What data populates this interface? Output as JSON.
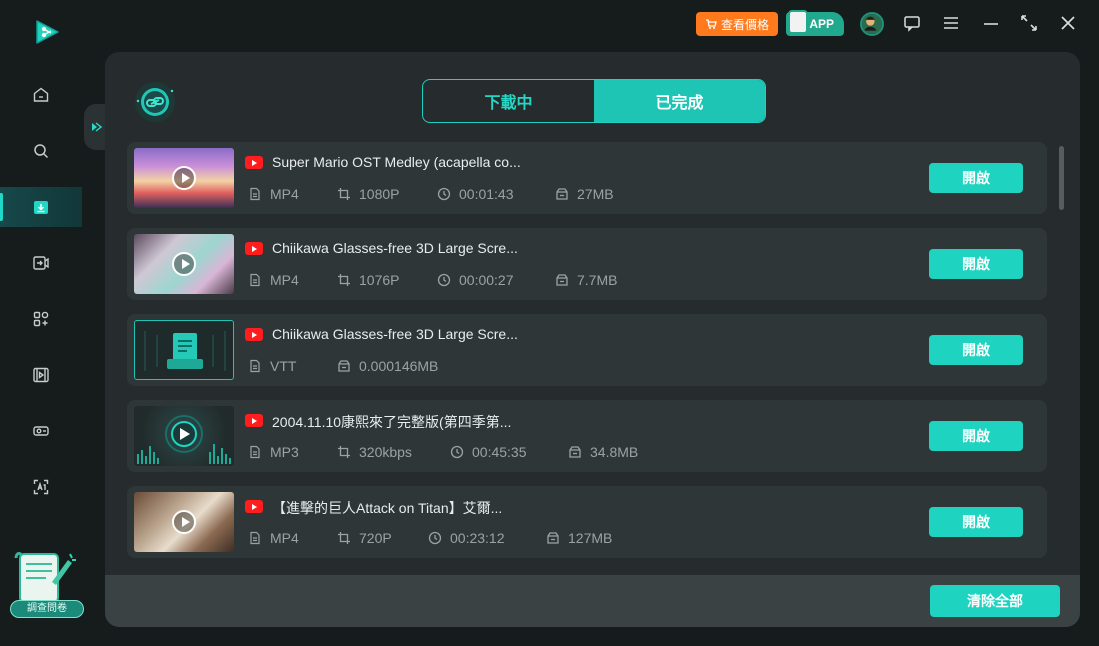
{
  "colors": {
    "accent": "#1ed3bf",
    "bg": "#161b1c",
    "panel": "#262c2d",
    "row": "#2f3637",
    "price": "#ff7a1c"
  },
  "titlebar": {
    "price_label": "查看價格",
    "app_label": "APP"
  },
  "sidebar": {
    "items": [
      {
        "icon": "home-icon"
      },
      {
        "icon": "search-icon"
      },
      {
        "icon": "download-icon",
        "active": true
      },
      {
        "icon": "video-convert-icon"
      },
      {
        "icon": "toolbox-icon"
      },
      {
        "icon": "video-edit-icon"
      },
      {
        "icon": "recorder-icon"
      },
      {
        "icon": "text-recognition-icon"
      }
    ],
    "survey_label": "調查問卷"
  },
  "tabs": [
    {
      "label": "下載中",
      "active": false
    },
    {
      "label": "已完成",
      "active": true
    }
  ],
  "items": [
    {
      "title": "Super Mario OST Medley (acapella co...",
      "format": "MP4",
      "quality": "1080P",
      "duration": "00:01:43",
      "size": "27MB",
      "thumb": "video",
      "action": "開啟"
    },
    {
      "title": "Chiikawa Glasses-free 3D Large Scre...",
      "format": "MP4",
      "quality": "1076P",
      "duration": "00:00:27",
      "size": "7.7MB",
      "thumb": "video",
      "action": "開啟"
    },
    {
      "title": "Chiikawa Glasses-free 3D Large Scre...",
      "format": "VTT",
      "quality": "",
      "duration": "",
      "size": "0.000146MB",
      "thumb": "subtitle",
      "action": "開啟"
    },
    {
      "title": "2004.11.10康熙來了完整版(第四季第...",
      "format": "MP3",
      "quality": "320kbps",
      "duration": "00:45:35",
      "size": "34.8MB",
      "thumb": "audio",
      "action": "開啟"
    },
    {
      "title": "【進擊的巨人Attack on Titan】艾爾...",
      "format": "MP4",
      "quality": "720P",
      "duration": "00:23:12",
      "size": "127MB",
      "thumb": "video",
      "action": "開啟"
    }
  ],
  "footer": {
    "clear_label": "清除全部"
  }
}
